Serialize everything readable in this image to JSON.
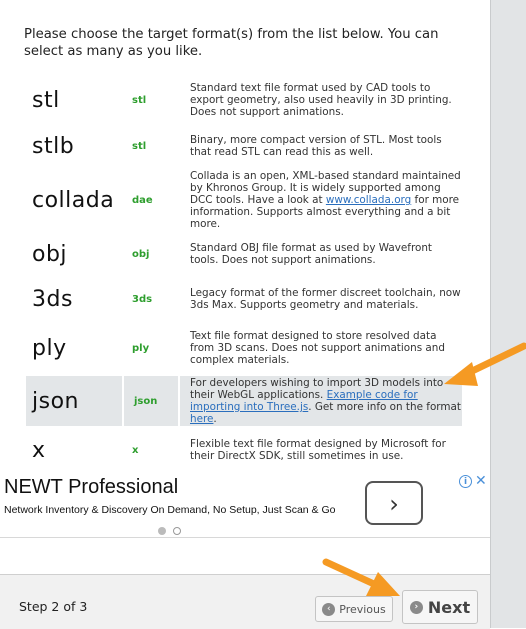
{
  "intro": "Please choose the target format(s) from the list below. You can select as many as you like.",
  "formats": [
    {
      "name": "stl",
      "ext": "stl",
      "desc": "Standard text file format used by CAD tools to export geometry, also used heavily in 3D printing. Does not support animations."
    },
    {
      "name": "stlb",
      "ext": "stl",
      "desc": "Binary, more compact version of STL. Most tools that read STL can read this as well."
    },
    {
      "name": "collada",
      "ext": "dae",
      "desc_pre": "Collada is an open, XML-based standard maintained by Khronos Group. It is widely supported among DCC tools. Have a look at ",
      "desc_link": "www.collada.org",
      "desc_post": " for more information. Supports almost everything and a bit more."
    },
    {
      "name": "obj",
      "ext": "obj",
      "desc": "Standard OBJ file format as used by Wavefront tools. Does not support animations."
    },
    {
      "name": "3ds",
      "ext": "3ds",
      "desc": "Legacy format of the former discreet toolchain, now 3ds Max. Supports geometry and materials."
    },
    {
      "name": "ply",
      "ext": "ply",
      "desc": "Text file format designed to store resolved data from 3D scans. Does not support animations and complex materials."
    },
    {
      "name": "json",
      "ext": "json",
      "desc_pre": "For developers wishing to import 3D models into their WebGL applications. ",
      "desc_link": "Example code for importing into Three.js",
      "desc_mid": ". Get more info on the format ",
      "desc_link2": "here",
      "desc_post": "."
    },
    {
      "name": "x",
      "ext": "x",
      "desc": "Flexible text file format designed by Microsoft for their DirectX SDK, still sometimes in use."
    }
  ],
  "ad": {
    "title": "NEWT Professional",
    "subtitle": "Network Inventory & Discovery On Demand, No Setup, Just Scan & Go",
    "button_glyph": "›",
    "info_glyph": "i",
    "close_glyph": "✕"
  },
  "footer": {
    "step": "Step 2 of 3",
    "prev_label": "Previous",
    "next_label": "Next",
    "prev_icon": "‹",
    "next_icon": "›"
  },
  "colors": {
    "accent_arrow": "#f59a23",
    "ext_green": "#2e9e2e",
    "link": "#2a6ebd",
    "selected_row": "#e3e6e8"
  }
}
